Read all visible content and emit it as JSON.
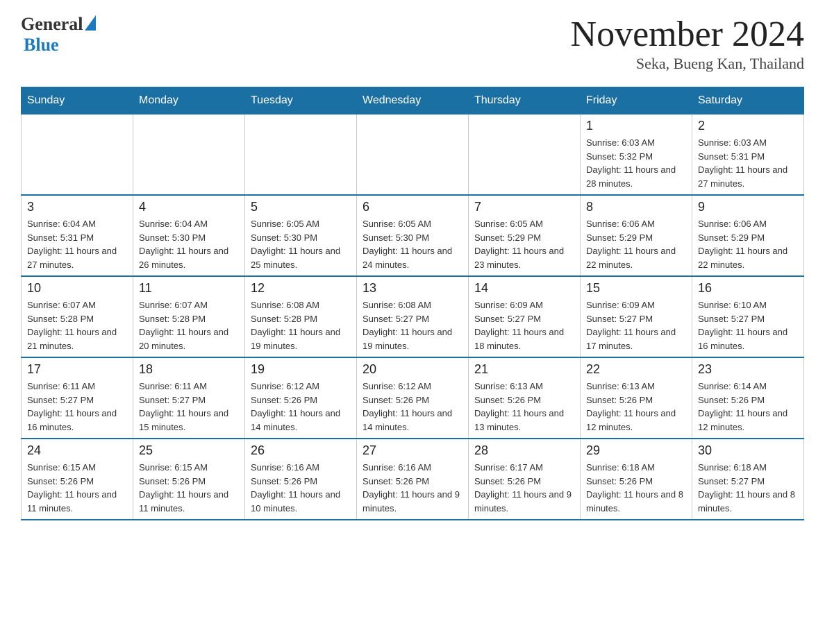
{
  "header": {
    "logo": {
      "general": "General",
      "blue": "Blue"
    },
    "title": "November 2024",
    "subtitle": "Seka, Bueng Kan, Thailand"
  },
  "calendar": {
    "days_of_week": [
      "Sunday",
      "Monday",
      "Tuesday",
      "Wednesday",
      "Thursday",
      "Friday",
      "Saturday"
    ],
    "weeks": [
      {
        "cells": [
          {
            "day": "",
            "info": ""
          },
          {
            "day": "",
            "info": ""
          },
          {
            "day": "",
            "info": ""
          },
          {
            "day": "",
            "info": ""
          },
          {
            "day": "",
            "info": ""
          },
          {
            "day": "1",
            "info": "Sunrise: 6:03 AM\nSunset: 5:32 PM\nDaylight: 11 hours and 28 minutes."
          },
          {
            "day": "2",
            "info": "Sunrise: 6:03 AM\nSunset: 5:31 PM\nDaylight: 11 hours and 27 minutes."
          }
        ]
      },
      {
        "cells": [
          {
            "day": "3",
            "info": "Sunrise: 6:04 AM\nSunset: 5:31 PM\nDaylight: 11 hours and 27 minutes."
          },
          {
            "day": "4",
            "info": "Sunrise: 6:04 AM\nSunset: 5:30 PM\nDaylight: 11 hours and 26 minutes."
          },
          {
            "day": "5",
            "info": "Sunrise: 6:05 AM\nSunset: 5:30 PM\nDaylight: 11 hours and 25 minutes."
          },
          {
            "day": "6",
            "info": "Sunrise: 6:05 AM\nSunset: 5:30 PM\nDaylight: 11 hours and 24 minutes."
          },
          {
            "day": "7",
            "info": "Sunrise: 6:05 AM\nSunset: 5:29 PM\nDaylight: 11 hours and 23 minutes."
          },
          {
            "day": "8",
            "info": "Sunrise: 6:06 AM\nSunset: 5:29 PM\nDaylight: 11 hours and 22 minutes."
          },
          {
            "day": "9",
            "info": "Sunrise: 6:06 AM\nSunset: 5:29 PM\nDaylight: 11 hours and 22 minutes."
          }
        ]
      },
      {
        "cells": [
          {
            "day": "10",
            "info": "Sunrise: 6:07 AM\nSunset: 5:28 PM\nDaylight: 11 hours and 21 minutes."
          },
          {
            "day": "11",
            "info": "Sunrise: 6:07 AM\nSunset: 5:28 PM\nDaylight: 11 hours and 20 minutes."
          },
          {
            "day": "12",
            "info": "Sunrise: 6:08 AM\nSunset: 5:28 PM\nDaylight: 11 hours and 19 minutes."
          },
          {
            "day": "13",
            "info": "Sunrise: 6:08 AM\nSunset: 5:27 PM\nDaylight: 11 hours and 19 minutes."
          },
          {
            "day": "14",
            "info": "Sunrise: 6:09 AM\nSunset: 5:27 PM\nDaylight: 11 hours and 18 minutes."
          },
          {
            "day": "15",
            "info": "Sunrise: 6:09 AM\nSunset: 5:27 PM\nDaylight: 11 hours and 17 minutes."
          },
          {
            "day": "16",
            "info": "Sunrise: 6:10 AM\nSunset: 5:27 PM\nDaylight: 11 hours and 16 minutes."
          }
        ]
      },
      {
        "cells": [
          {
            "day": "17",
            "info": "Sunrise: 6:11 AM\nSunset: 5:27 PM\nDaylight: 11 hours and 16 minutes."
          },
          {
            "day": "18",
            "info": "Sunrise: 6:11 AM\nSunset: 5:27 PM\nDaylight: 11 hours and 15 minutes."
          },
          {
            "day": "19",
            "info": "Sunrise: 6:12 AM\nSunset: 5:26 PM\nDaylight: 11 hours and 14 minutes."
          },
          {
            "day": "20",
            "info": "Sunrise: 6:12 AM\nSunset: 5:26 PM\nDaylight: 11 hours and 14 minutes."
          },
          {
            "day": "21",
            "info": "Sunrise: 6:13 AM\nSunset: 5:26 PM\nDaylight: 11 hours and 13 minutes."
          },
          {
            "day": "22",
            "info": "Sunrise: 6:13 AM\nSunset: 5:26 PM\nDaylight: 11 hours and 12 minutes."
          },
          {
            "day": "23",
            "info": "Sunrise: 6:14 AM\nSunset: 5:26 PM\nDaylight: 11 hours and 12 minutes."
          }
        ]
      },
      {
        "cells": [
          {
            "day": "24",
            "info": "Sunrise: 6:15 AM\nSunset: 5:26 PM\nDaylight: 11 hours and 11 minutes."
          },
          {
            "day": "25",
            "info": "Sunrise: 6:15 AM\nSunset: 5:26 PM\nDaylight: 11 hours and 11 minutes."
          },
          {
            "day": "26",
            "info": "Sunrise: 6:16 AM\nSunset: 5:26 PM\nDaylight: 11 hours and 10 minutes."
          },
          {
            "day": "27",
            "info": "Sunrise: 6:16 AM\nSunset: 5:26 PM\nDaylight: 11 hours and 9 minutes."
          },
          {
            "day": "28",
            "info": "Sunrise: 6:17 AM\nSunset: 5:26 PM\nDaylight: 11 hours and 9 minutes."
          },
          {
            "day": "29",
            "info": "Sunrise: 6:18 AM\nSunset: 5:26 PM\nDaylight: 11 hours and 8 minutes."
          },
          {
            "day": "30",
            "info": "Sunrise: 6:18 AM\nSunset: 5:27 PM\nDaylight: 11 hours and 8 minutes."
          }
        ]
      }
    ]
  }
}
